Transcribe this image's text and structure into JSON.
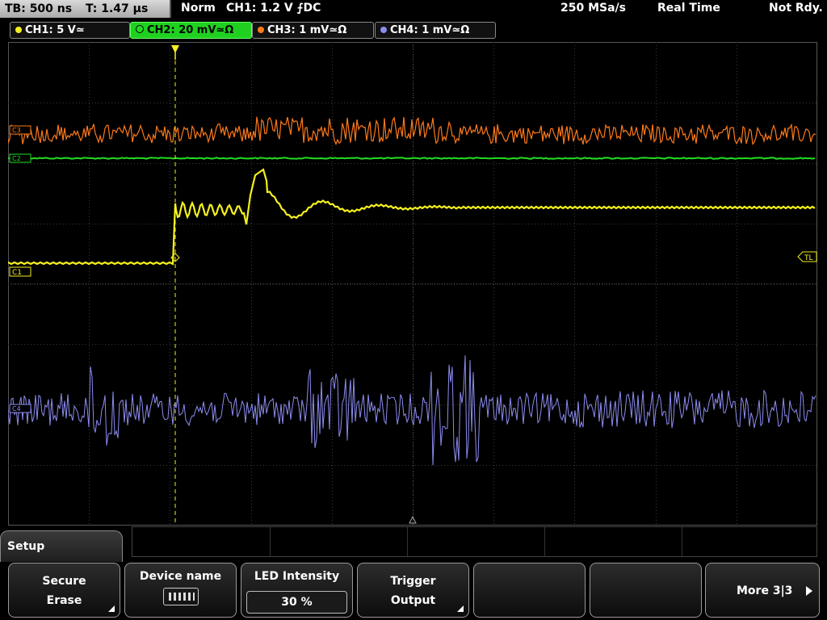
{
  "topbar": {
    "timebase": "TB: 500 ns",
    "trigger_time": "T: 1.47 µs",
    "mode": "Norm",
    "trigger_info": "CH1: 1.2 V ⨍DC",
    "sample_rate": "250 MSa/s",
    "acq_mode": "Real Time",
    "status": "Not Rdy."
  },
  "channels": [
    {
      "label": "CH1: 5 V≃",
      "color": "#f4f01e",
      "active": false
    },
    {
      "label": "CH2: 20 mV≃Ω",
      "color": "#22dd22",
      "active": true
    },
    {
      "label": "CH3: 1 mV≃Ω",
      "color": "#ff7a1a",
      "active": false
    },
    {
      "label": "CH4: 1 mV≃Ω",
      "color": "#8c8cf0",
      "active": false
    }
  ],
  "markers": {
    "ch1": "C1",
    "trigger_level": "TL",
    "ch2": "C2",
    "ch3": "C3",
    "ch4": "C4"
  },
  "menu": {
    "title": "Setup",
    "softkeys": [
      {
        "line1": "Secure",
        "line2": "Erase"
      },
      {
        "line1": "Device name",
        "icon": "keyboard-icon"
      },
      {
        "line1": "LED Intensity",
        "value": "30 %"
      },
      {
        "line1": "Trigger",
        "line2": "Output"
      },
      {
        "line1": "",
        "line2": ""
      },
      {
        "line1": "",
        "line2": ""
      },
      {
        "line1": "More 3|3"
      }
    ]
  },
  "colors": {
    "ch1": "#f4f01e",
    "ch2": "#22dd22",
    "ch3": "#ff7a1a",
    "ch4": "#8c8cf0",
    "grid": "#3a3a3a"
  }
}
